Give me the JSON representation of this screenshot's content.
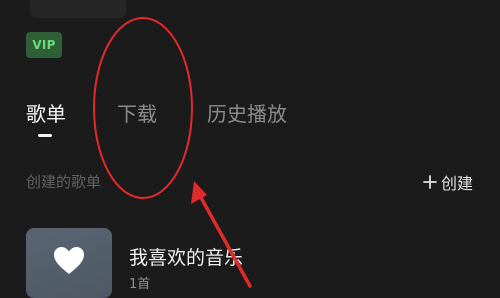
{
  "badge": {
    "vip": "VIP"
  },
  "tabs": [
    {
      "label": "歌单",
      "active": true
    },
    {
      "label": "下载",
      "active": false
    },
    {
      "label": "历史播放",
      "active": false
    }
  ],
  "section": {
    "label": "创建的歌单",
    "create_label": "创建"
  },
  "playlist": {
    "title": "我喜欢的音乐",
    "count": "1首"
  },
  "icons": {
    "create": "plus-icon",
    "cover": "heart-icon"
  },
  "colors": {
    "background": "#1b1b1b",
    "vip_badge_bg": "#2f5f36",
    "vip_badge_text": "#6ed978",
    "annotation": "#e12a2a"
  }
}
